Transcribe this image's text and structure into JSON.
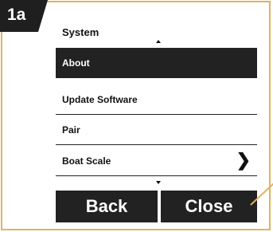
{
  "step_label": "1a",
  "menu": {
    "title": "System",
    "items": [
      {
        "label": "About",
        "selected": true
      },
      {
        "label": "Update Software",
        "selected": false
      },
      {
        "label": "Pair",
        "selected": false
      },
      {
        "label": "Boat Scale",
        "selected": false,
        "has_submenu": true
      }
    ]
  },
  "buttons": {
    "back": "Back",
    "close": "Close"
  },
  "icons": {
    "scroll_up": "up-arrow-icon",
    "scroll_down": "down-arrow-icon",
    "submenu": "chevron-right-icon"
  },
  "colors": {
    "frame_border": "#e2b25f",
    "selected_bg": "#222222"
  }
}
